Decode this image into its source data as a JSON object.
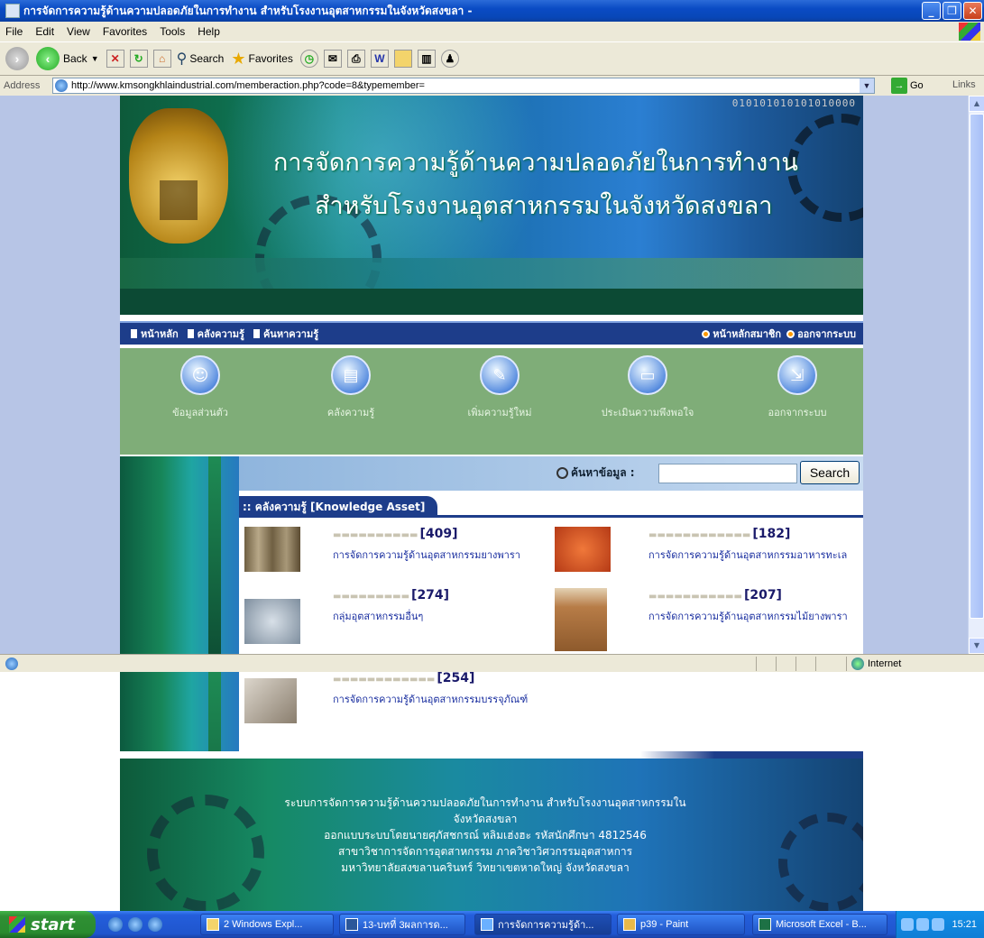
{
  "window": {
    "title": "การจัดการความรู้ด้านความปลอดภัยในการทำงาน สำหรับโรงงานอุตสาหกรรมในจังหวัดสงขลา -"
  },
  "menu": [
    "File",
    "Edit",
    "View",
    "Favorites",
    "Tools",
    "Help"
  ],
  "toolbar": {
    "back_label": "Back",
    "search_label": "Search",
    "favorites_label": "Favorites"
  },
  "address": {
    "label": "Address",
    "url": "http://www.kmsongkhlaindustrial.com/memberaction.php?code=8&typemember=",
    "go_label": "Go",
    "links_label": "Links"
  },
  "site": {
    "banner": {
      "title_line1": "การจัดการความรู้ด้านความปลอดภัยในการทำงาน",
      "title_line2": "สำหรับโรงงานอุตสาหกรรมในจังหวัดสงขลา",
      "binary": "010101010101010000"
    },
    "nav_left": [
      "หน้าหลัก",
      "คลังความรู้",
      "ค้นหาความรู้"
    ],
    "nav_right": [
      "หน้าหลักสมาชิก",
      "ออกจากระบบ"
    ],
    "icon_menu": [
      "ข้อมูลส่วนตัว",
      "คลังความรู้",
      "เพิ่มความรู้ใหม่",
      "ประเมินความพึงพอใจ",
      "ออกจากระบบ"
    ],
    "search": {
      "label": "ค้นหาข้อมูล :",
      "value": "",
      "button": "Search"
    },
    "section_title": ":: คลังความรู้ [Knowledge Asset]",
    "categories": [
      {
        "count": "[409]",
        "link": "การจัดการความรู้ด้านอุตสาหกรรมยางพารา",
        "thumb_color": "#8a7a5a"
      },
      {
        "count": "[182]",
        "link": "การจัดการความรู้ด้านอุตสาหกรรมอาหารทะเล",
        "thumb_color": "#d2542a"
      },
      {
        "count": "[274]",
        "link": "กลุ่มอุตสาหกรรมอื่นๆ",
        "thumb_color": "#8a99a8"
      },
      {
        "count": "[207]",
        "link": "การจัดการความรู้ด้านอุตสาหกรรมไม้ยางพารา",
        "thumb_color": "#b77c47"
      },
      {
        "count": "[254]",
        "link": "การจัดการความรู้ด้านอุตสาหกรรมบรรจุภัณฑ์",
        "thumb_color": "#a59a8a"
      }
    ],
    "footer": [
      "ระบบการจัดการความรู้ด้านความปลอดภัยในการทำงาน สำหรับโรงงานอุตสาหกรรมในจังหวัดสงขลา",
      "ออกแบบระบบโดยนายศุภัสชกรณ์ หลิมเฮ่งฮะ รหัสนักศึกษา 4812546",
      "สาขาวิชาการจัดการอุตสาหกรรม ภาควิชาวิศวกรรมอุตสาหการ",
      "มหาวิทยาลัยสงขลานครินทร์ วิทยาเขตหาดใหญ่ จังหวัดสงขลา"
    ]
  },
  "statusbar": {
    "zone": "Internet"
  },
  "taskbar": {
    "start": "start",
    "tasks": [
      "2 Windows Expl...",
      "13-บทที่ 3ผลการด...",
      "การจัดการความรู้ด้า...",
      "p39 - Paint",
      "Microsoft Excel - B..."
    ],
    "clock": "15:21"
  }
}
